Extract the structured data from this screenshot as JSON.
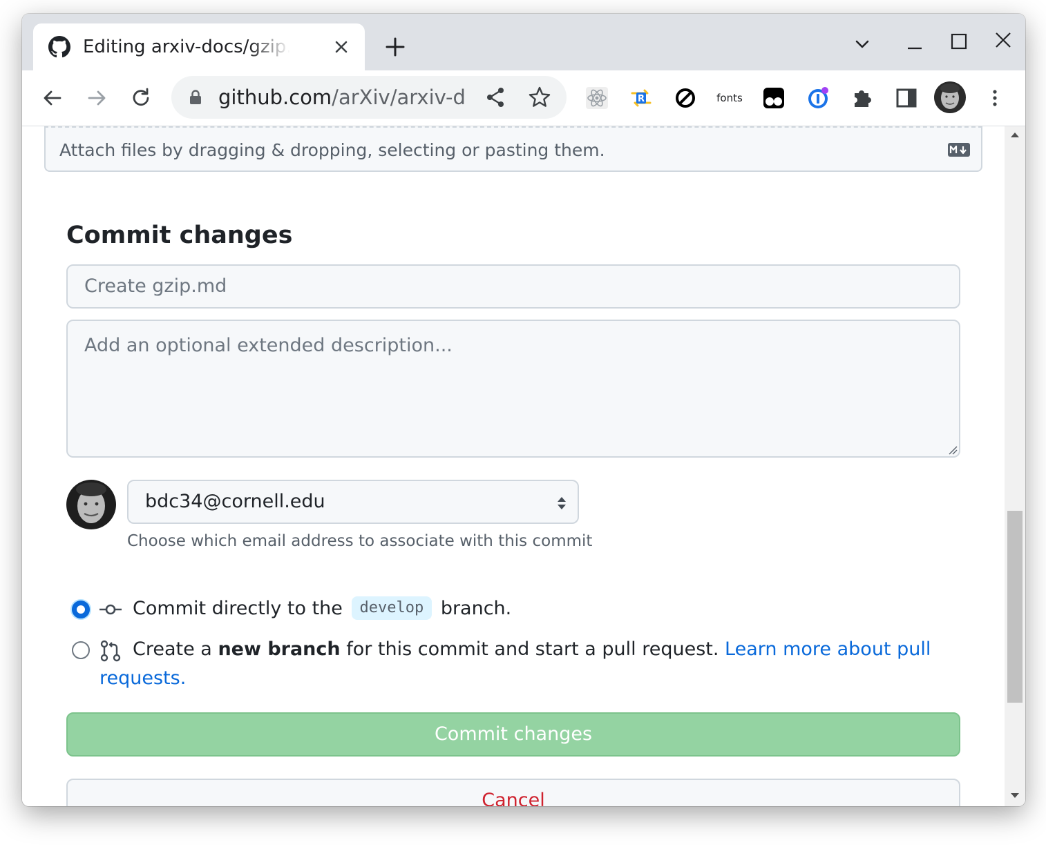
{
  "browser": {
    "tab": {
      "title": "Editing arxiv-docs/gzip.md at develop",
      "favicon": "github-icon"
    },
    "url": {
      "host": "github.com",
      "path": "/arXiv/arxiv-d..."
    },
    "extensions": {
      "fonts_label": "fonts"
    }
  },
  "editor": {
    "attach_text": "Attach files by dragging & dropping, selecting or pasting them."
  },
  "commit": {
    "heading": "Commit changes",
    "summary_placeholder": "Create gzip.md",
    "description_placeholder": "Add an optional extended description...",
    "email": {
      "selected": "bdc34@cornell.edu",
      "help": "Choose which email address to associate with this commit"
    },
    "options": {
      "direct": {
        "prefix": "Commit directly to the",
        "branch": "develop",
        "suffix": "branch.",
        "selected": true
      },
      "new_branch": {
        "prefix": "Create a",
        "bold": "new branch",
        "middle": "for this commit and start a pull request.",
        "link": "Learn more about pull",
        "link_cont": "requests.",
        "selected": false
      }
    },
    "submit_label": "Commit changes",
    "cancel_label": "Cancel"
  },
  "colors": {
    "accent": "#0969da",
    "commit_button": "#94d3a2",
    "cancel_text": "#cf222e"
  }
}
